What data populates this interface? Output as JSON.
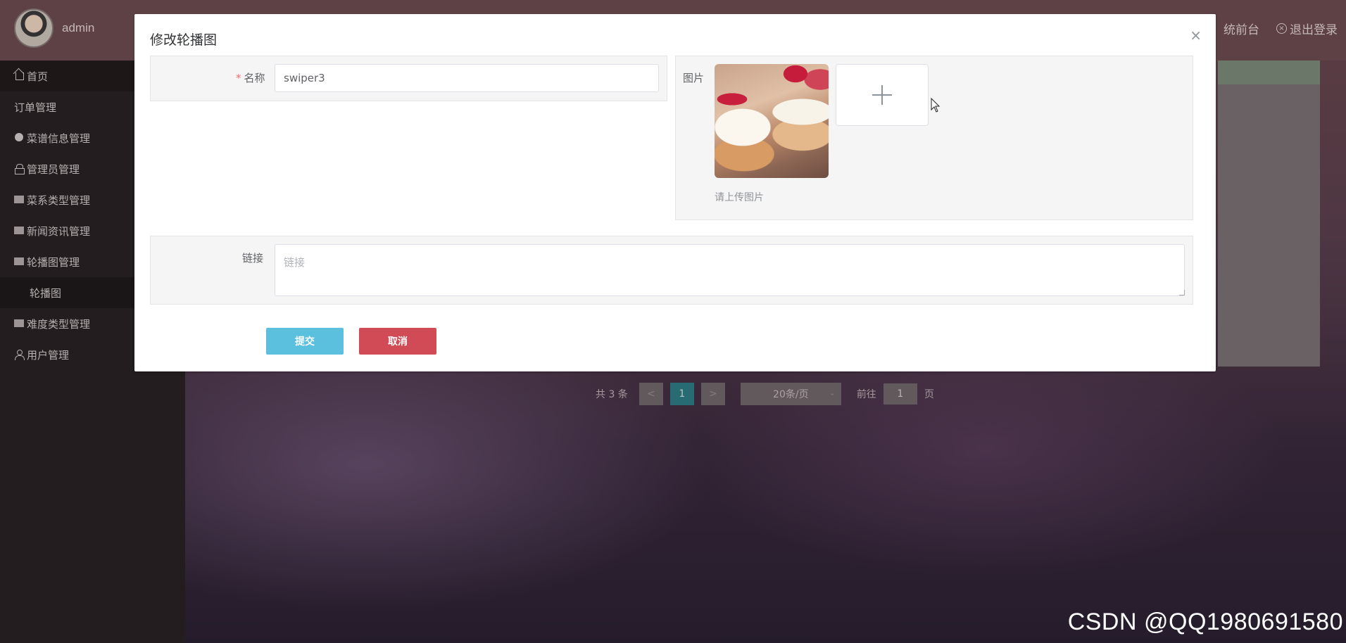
{
  "header": {
    "username": "admin",
    "links": [
      {
        "label": "统前台"
      },
      {
        "label": "退出登录"
      }
    ]
  },
  "sidebar": {
    "items": [
      {
        "label": "首页",
        "icon": "home-icon"
      },
      {
        "label": "订单管理",
        "icon": ""
      },
      {
        "label": "菜谱信息管理",
        "icon": "circle-icon"
      },
      {
        "label": "管理员管理",
        "icon": "lock-icon"
      },
      {
        "label": "菜系类型管理",
        "icon": "card-icon"
      },
      {
        "label": "新闻资讯管理",
        "icon": "card-icon"
      },
      {
        "label": "轮播图管理",
        "icon": "card-icon"
      },
      {
        "label": "轮播图",
        "icon": "",
        "sub": true
      },
      {
        "label": "难度类型管理",
        "icon": "card-icon"
      },
      {
        "label": "用户管理",
        "icon": "user-icon"
      }
    ]
  },
  "pagination": {
    "total": "共 3 条",
    "prev": "<",
    "current": "1",
    "next": ">",
    "page_size": "20条/页",
    "goto_label": "前往",
    "goto_value": "1",
    "goto_suffix": "页"
  },
  "dialog": {
    "title": "修改轮播图",
    "close": "×",
    "name_label": "名称",
    "name_value": "swiper3",
    "image_label": "图片",
    "upload_tip": "请上传图片",
    "link_label": "链接",
    "link_placeholder": "链接",
    "submit_label": "提交",
    "cancel_label": "取消"
  },
  "watermark": "CSDN @QQ1980691580",
  "colors": {
    "submit": "#5bc0de",
    "cancel": "#d14b56",
    "current_page": "#2f7e86"
  }
}
